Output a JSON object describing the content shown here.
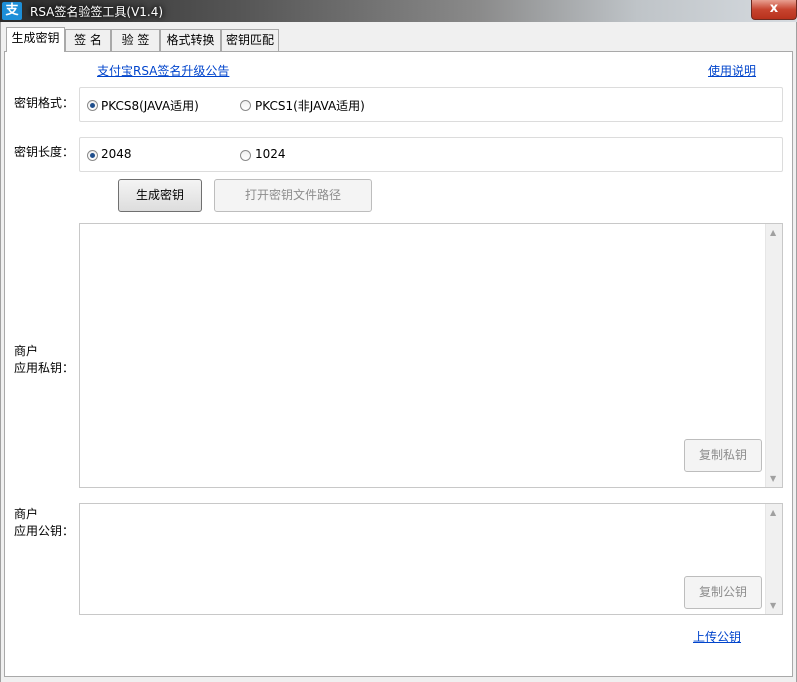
{
  "window": {
    "title": "RSA签名验签工具(V1.4)",
    "app_icon": "支",
    "close_label": "x"
  },
  "tabs": [
    {
      "label": "生成密钥",
      "active": true
    },
    {
      "label": "签 名",
      "active": false
    },
    {
      "label": "验 签",
      "active": false
    },
    {
      "label": "格式转换",
      "active": false
    },
    {
      "label": "密钥匹配",
      "active": false
    }
  ],
  "links": {
    "announcement": "支付宝RSA签名升级公告",
    "usage": "使用说明",
    "upload_public_key": "上传公钥"
  },
  "key_format": {
    "label": "密钥格式：",
    "options": [
      "PKCS8(JAVA适用)",
      "PKCS1(非JAVA适用)"
    ],
    "selected": "PKCS8(JAVA适用)"
  },
  "key_length": {
    "label": "密钥长度：",
    "options": [
      "2048",
      "1024"
    ],
    "selected": "2048"
  },
  "buttons": {
    "generate": "生成密钥",
    "open_path": "打开密钥文件路径",
    "copy_private": "复制私钥",
    "copy_public": "复制公钥"
  },
  "private_key": {
    "label_line1": "商户",
    "label_line2": "应用私钥：",
    "value": ""
  },
  "public_key": {
    "label_line1": "商户",
    "label_line2": "应用公钥：",
    "value": ""
  },
  "colors": {
    "link": "#0044cc",
    "radio_selected": "#1f4e8c"
  }
}
